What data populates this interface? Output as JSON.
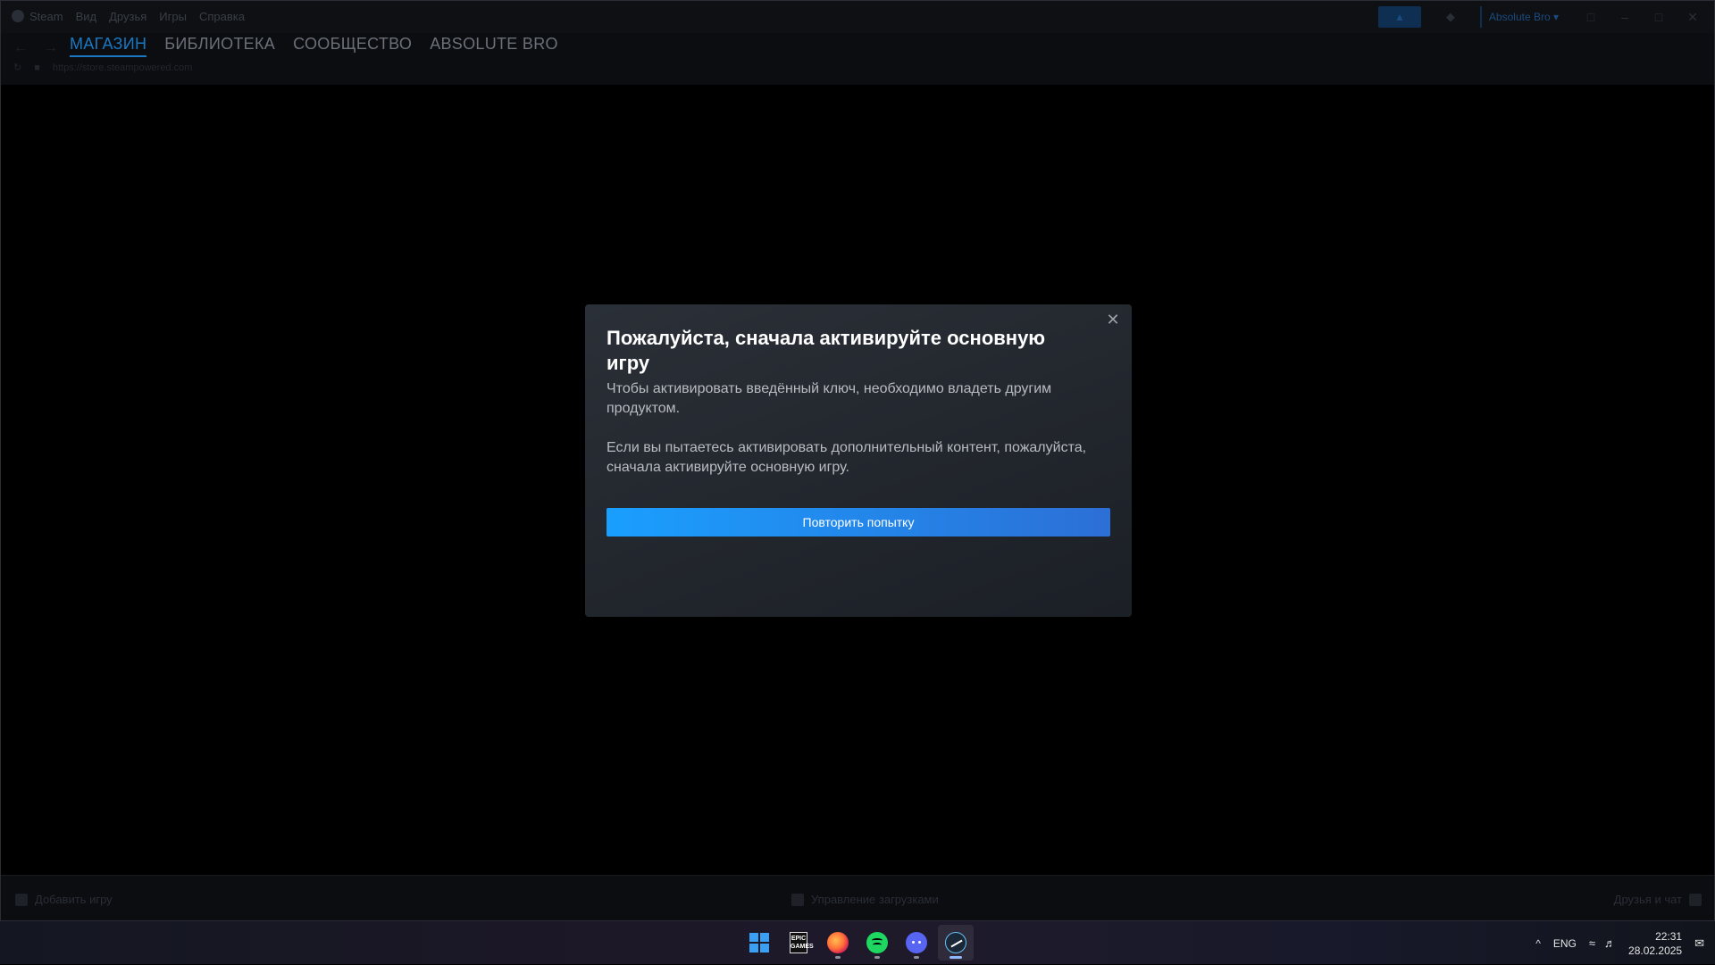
{
  "titlebar": {
    "menu": [
      "Steam",
      "Вид",
      "Друзья",
      "Игры",
      "Справка"
    ],
    "user": "Absolute Bro"
  },
  "nav": {
    "tabs": [
      "МАГАЗИН",
      "БИБЛИОТЕКА",
      "СООБЩЕСТВО",
      "ABSOLUTE BRO"
    ],
    "url": "https://store.steampowered.com"
  },
  "bottombar": {
    "add_game": "Добавить игру",
    "downloads": "Управление загрузками",
    "friends": "Друзья и чат"
  },
  "dialog": {
    "title": "Пожалуйста, сначала активируйте основную игру",
    "paragraph1": "Чтобы активировать введённый ключ, необходимо владеть другим продуктом.",
    "paragraph2": "Если вы пытаетесь активировать дополнительный контент, пожалуйста, сначала активируйте основную игру.",
    "retry_label": "Повторить попытку",
    "close_icon": "close-icon"
  },
  "taskbar": {
    "apps": [
      "windows-start-icon",
      "epic-games-icon",
      "firefox-icon",
      "spotify-icon",
      "discord-icon",
      "steam-icon"
    ],
    "epic_text": "EPIC GAMES",
    "chevron": "^",
    "language": "ENG",
    "time": "22:31",
    "date": "28.02.2025"
  },
  "colors": {
    "accent_blue": "#1a9fff",
    "active_tab": "#1a78c2",
    "dialog_bg": "#22262d"
  }
}
